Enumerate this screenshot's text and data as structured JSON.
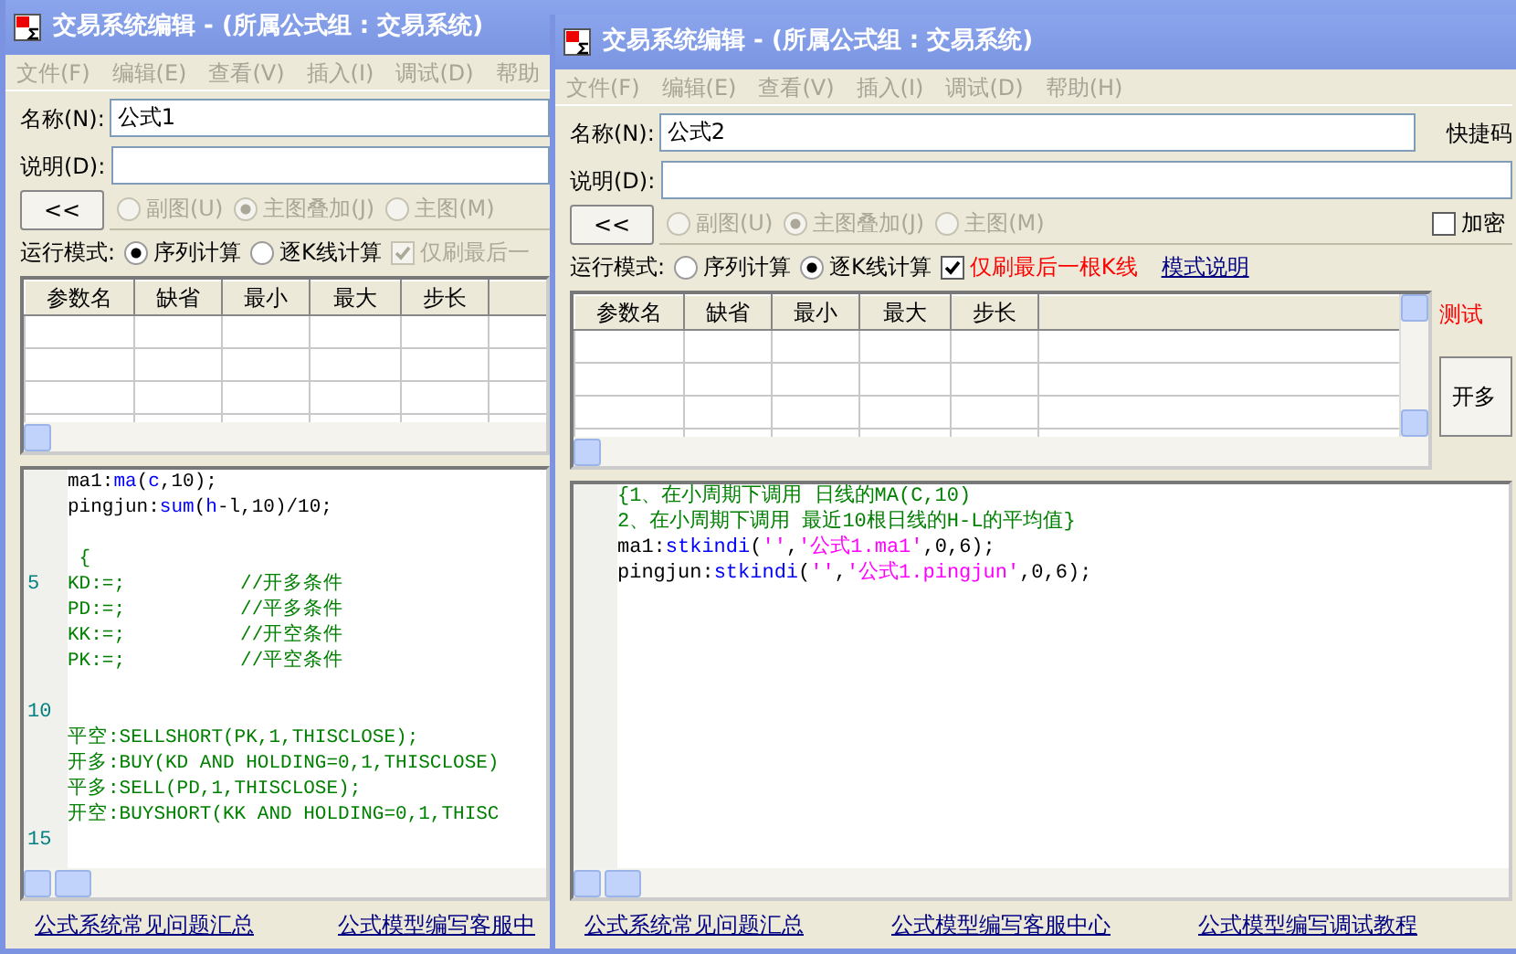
{
  "windows": [
    {
      "title": "交易系统编辑 - (所属公式组 : 交易系统)",
      "menu": [
        {
          "label": "文件(F)",
          "disabled": true
        },
        {
          "label": "编辑(E)",
          "disabled": true
        },
        {
          "label": "查看(V)",
          "disabled": true
        },
        {
          "label": "插入(I)",
          "disabled": true
        },
        {
          "label": "调试(D)",
          "disabled": true
        },
        {
          "label": "帮助",
          "disabled": true
        }
      ],
      "name": {
        "label": "名称(N):",
        "value": "公式1"
      },
      "description": {
        "label": "说明(D):"
      },
      "collapse_button": "<<",
      "chart_types": [
        {
          "label": "副图(U)",
          "selected": false,
          "disabled": true
        },
        {
          "label": "主图叠加(J)",
          "selected": true,
          "disabled": true
        },
        {
          "label": "主图(M)",
          "selected": false,
          "disabled": true
        }
      ],
      "run_mode": {
        "label": "运行模式:",
        "options": [
          {
            "label": "序列计算",
            "selected": true
          },
          {
            "label": "逐K线计算",
            "selected": false
          }
        ],
        "refresh": {
          "label": "仅刷最后一",
          "checked": true,
          "disabled": true
        }
      },
      "params_table": {
        "columns": [
          "参数名",
          "缺省",
          "最小",
          "最大",
          "步长"
        ]
      },
      "code": [
        {
          "kind": "code",
          "segments": [
            {
              "kind": "text",
              "text": "ma1:"
            },
            {
              "kind": "function",
              "text": "ma"
            },
            {
              "kind": "text",
              "text": "("
            },
            {
              "kind": "function",
              "text": "c"
            },
            {
              "kind": "text",
              "text": ",10);"
            }
          ]
        },
        {
          "kind": "code",
          "segments": [
            {
              "kind": "text",
              "text": "pingjun:"
            },
            {
              "kind": "function",
              "text": "sum"
            },
            {
              "kind": "text",
              "text": "("
            },
            {
              "kind": "function",
              "text": "h"
            },
            {
              "kind": "text",
              "text": "-l,10)/10;"
            }
          ]
        },
        {
          "kind": "blank"
        },
        {
          "kind": "code",
          "segments": [
            {
              "kind": "comment",
              "text": " {"
            }
          ]
        },
        {
          "kind": "code",
          "number": "5",
          "segments": [
            {
              "kind": "comment",
              "text": "KD:=;          //开多条件"
            }
          ]
        },
        {
          "kind": "code",
          "segments": [
            {
              "kind": "comment",
              "text": "PD:=;          //平多条件"
            }
          ]
        },
        {
          "kind": "code",
          "segments": [
            {
              "kind": "comment",
              "text": "KK:=;          //开空条件"
            }
          ]
        },
        {
          "kind": "code",
          "segments": [
            {
              "kind": "comment",
              "text": "PK:=;          //平空条件"
            }
          ]
        },
        {
          "kind": "blank"
        },
        {
          "kind": "blank",
          "number": "10"
        },
        {
          "kind": "code",
          "segments": [
            {
              "kind": "comment",
              "text": "平空:SELLSHORT(PK,1,THISCLOSE);"
            }
          ]
        },
        {
          "kind": "code",
          "segments": [
            {
              "kind": "comment",
              "text": "开多:BUY(KD AND HOLDING=0,1,THISCLOSE)"
            }
          ]
        },
        {
          "kind": "code",
          "segments": [
            {
              "kind": "comment",
              "text": "平多:SELL(PD,1,THISCLOSE);"
            }
          ]
        },
        {
          "kind": "code",
          "segments": [
            {
              "kind": "comment",
              "text": "开空:BUYSHORT(KK AND HOLDING=0,1,THISC"
            }
          ]
        },
        {
          "kind": "blank",
          "number": "15"
        }
      ],
      "footer_links": [
        "公式系统常见问题汇总",
        "公式模型编写客服中"
      ]
    },
    {
      "title": "交易系统编辑 - (所属公式组 : 交易系统)",
      "menu": [
        {
          "label": "文件(F)",
          "disabled": true
        },
        {
          "label": "编辑(E)",
          "disabled": true
        },
        {
          "label": "查看(V)",
          "disabled": true
        },
        {
          "label": "插入(I)",
          "disabled": true
        },
        {
          "label": "调试(D)",
          "disabled": true
        },
        {
          "label": "帮助(H)",
          "disabled": true
        }
      ],
      "name": {
        "label": "名称(N):",
        "value": "公式2"
      },
      "shortcut_label": "快捷码",
      "description": {
        "label": "说明(D):"
      },
      "collapse_button": "<<",
      "chart_types": [
        {
          "label": "副图(U)",
          "selected": false,
          "disabled": true
        },
        {
          "label": "主图叠加(J)",
          "selected": true,
          "disabled": true
        },
        {
          "label": "主图(M)",
          "selected": false,
          "disabled": true
        }
      ],
      "encrypt": {
        "label": "加密",
        "checked": false
      },
      "run_mode": {
        "label": "运行模式:",
        "options": [
          {
            "label": "序列计算",
            "selected": false
          },
          {
            "label": "逐K线计算",
            "selected": true
          }
        ],
        "refresh": {
          "label": "仅刷最后一根K线",
          "checked": true,
          "disabled": false
        },
        "help_link": "模式说明"
      },
      "params_table": {
        "columns": [
          "参数名",
          "缺省",
          "最小",
          "最大",
          "步长"
        ]
      },
      "side": {
        "test_label": "测试",
        "button": "开多"
      },
      "code": [
        {
          "kind": "code",
          "segments": [
            {
              "kind": "comment",
              "text": "{1、在小周期下调用 日线的MA(C,10)"
            }
          ]
        },
        {
          "kind": "code",
          "segments": [
            {
              "kind": "comment",
              "text": "2、在小周期下调用 最近10根日线的H-L的平均值}"
            }
          ]
        },
        {
          "kind": "code",
          "segments": [
            {
              "kind": "text",
              "text": "ma1:"
            },
            {
              "kind": "function",
              "text": "stkindi"
            },
            {
              "kind": "text",
              "text": "("
            },
            {
              "kind": "string",
              "text": "''"
            },
            {
              "kind": "text",
              "text": ","
            },
            {
              "kind": "string",
              "text": "'公式1.ma1'"
            },
            {
              "kind": "text",
              "text": ",0,6);"
            }
          ]
        },
        {
          "kind": "code",
          "segments": [
            {
              "kind": "text",
              "text": "pingjun:"
            },
            {
              "kind": "function",
              "text": "stkindi"
            },
            {
              "kind": "text",
              "text": "("
            },
            {
              "kind": "string",
              "text": "''"
            },
            {
              "kind": "text",
              "text": ","
            },
            {
              "kind": "string",
              "text": "'公式1.pingjun'"
            },
            {
              "kind": "text",
              "text": ",0,6);"
            }
          ]
        }
      ],
      "footer_links": [
        "公式系统常见问题汇总",
        "公式模型编写客服中心",
        "公式模型编写调试教程"
      ]
    }
  ]
}
